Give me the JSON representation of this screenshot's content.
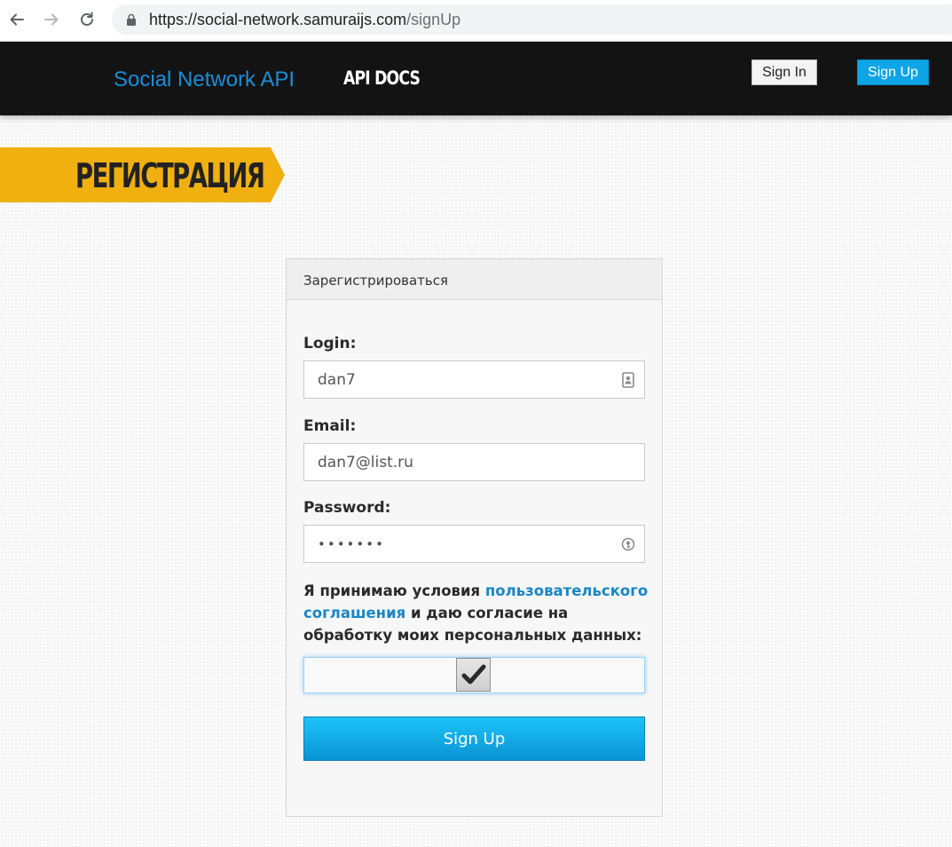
{
  "browser": {
    "url_host": "https://social-network.samuraijs.com",
    "url_path": "/signUp"
  },
  "header": {
    "brand": "Social Network API",
    "api_docs": "API DOCS",
    "sign_in": "Sign In",
    "sign_up": "Sign Up"
  },
  "page": {
    "title": "РЕГИСТРАЦИЯ"
  },
  "form": {
    "heading": "Зарегистрироваться",
    "login_label": "Login:",
    "login_value": "dan7",
    "email_label": "Email:",
    "email_value": "dan7@list.ru",
    "password_label": "Password:",
    "password_value": "•••••••",
    "terms_before": "Я принимаю условия ",
    "terms_link": "пользовательского соглашения",
    "terms_after": " и даю согласие на обработку моих персональных данных:",
    "agree_checked": true,
    "submit": "Sign Up"
  },
  "colors": {
    "brand": "#1a8ed8",
    "header_bg": "#131313",
    "ribbon": "#efb010",
    "primary_button": "#0ea4e6",
    "link": "#1a86c5"
  }
}
